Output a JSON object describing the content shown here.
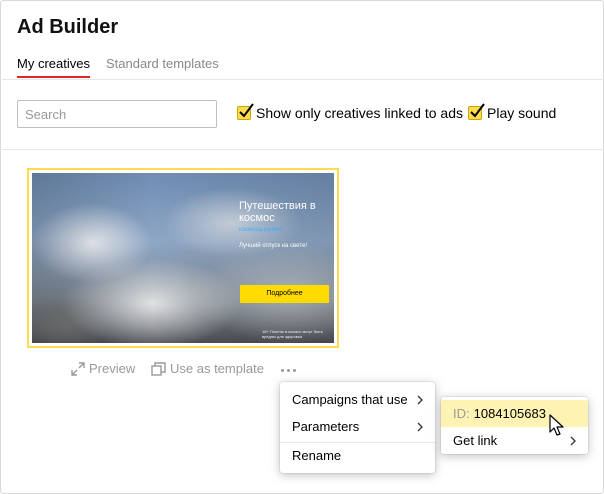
{
  "app": {
    "title": "Ad Builder"
  },
  "tabs": [
    {
      "label": "My creatives"
    },
    {
      "label": "Standard templates"
    }
  ],
  "filters": {
    "search_placeholder": "Search",
    "search_value": "",
    "only_linked": {
      "label": "Show only creatives linked to ads",
      "checked": true
    },
    "play_sound": {
      "label": "Play sound",
      "checked": true
    }
  },
  "creative": {
    "banner": {
      "headline": "Путешествия в космос",
      "link": "космоса.yandex",
      "subtitle": "Лучший отпуск на свете!",
      "button": "Подробнее",
      "disclaimer": "18+ Полеты в космос могут быть вредны для здоровья"
    },
    "actions": {
      "preview": "Preview",
      "use_template": "Use as template"
    }
  },
  "context_menu": {
    "items": [
      {
        "label": "Campaigns that use"
      },
      {
        "label": "Parameters"
      },
      {
        "label": "Rename"
      }
    ]
  },
  "submenu": {
    "id_label": "ID:",
    "id_value": "1084105683",
    "get_link": "Get link"
  },
  "colors": {
    "accent_yellow": "#ffdb4d",
    "tab_underline": "#e0262b",
    "highlight": "#fff3b3"
  }
}
